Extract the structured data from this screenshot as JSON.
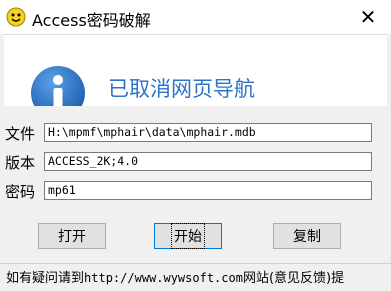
{
  "window": {
    "title": "Access密码破解",
    "close_glyph": "✕"
  },
  "web_area": {
    "message": "已取消网页导航"
  },
  "form": {
    "file_label": "文件",
    "file_value": "H:\\mpmf\\mphair\\data\\mphair.mdb",
    "version_label": "版本",
    "version_value": "ACCESS_2K;4.0",
    "password_label": "密码",
    "password_value": "mp61"
  },
  "buttons": {
    "open": "打开",
    "start": "开始",
    "copy": "复制"
  },
  "status": {
    "prefix": "如有疑问请到",
    "url": "http://www.wywsoft.com",
    "suffix": "网站(意见反馈)提"
  },
  "colors": {
    "link_blue": "#2b74c7",
    "info_icon_blue": "#1d5fae",
    "app_icon_yellow": "#f4d21b"
  }
}
